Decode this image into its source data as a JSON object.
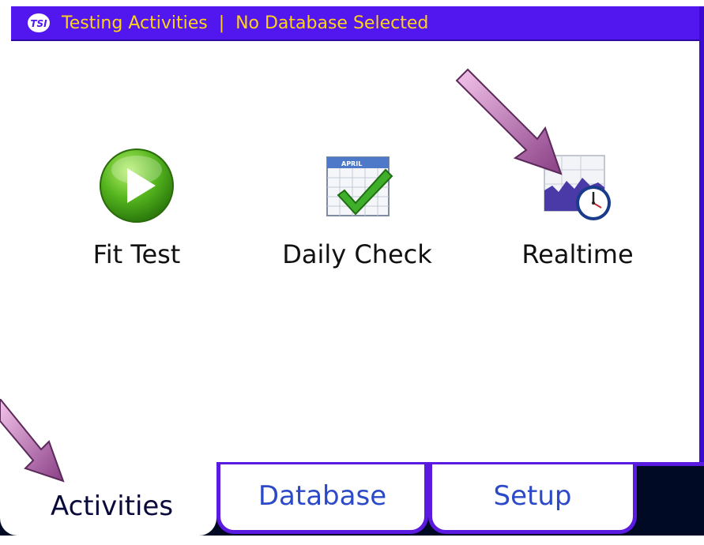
{
  "titlebar": {
    "logo_text": "TSI",
    "title": "Testing Activities  |  No Database Selected"
  },
  "activities": [
    {
      "label": "Fit Test",
      "icon": "play-icon"
    },
    {
      "label": "Daily Check",
      "icon": "calendar-check-icon",
      "calendar_month": "APRIL"
    },
    {
      "label": "Realtime",
      "icon": "realtime-chart-clock-icon"
    }
  ],
  "tabs": {
    "activities": "Activities",
    "database": "Database",
    "setup": "Setup",
    "selected": "Activities"
  },
  "annotations": [
    "arrow-pointer",
    "arrow-pointer"
  ],
  "colors": {
    "titlebar_bg": "#5217ee",
    "title_text": "#ffd21a",
    "tab_border": "#5a1ae0",
    "tab_text_inactive": "#2c49c8",
    "tab_text_active": "#0a0a3a",
    "arrow": "#c06fb5"
  }
}
